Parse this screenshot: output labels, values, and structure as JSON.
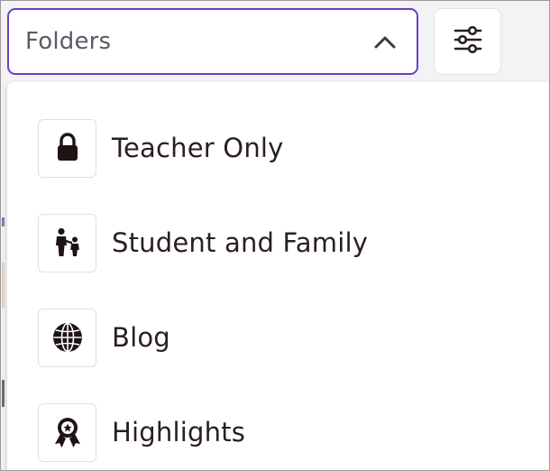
{
  "dropdown": {
    "label": "Folders",
    "chevron_icon": "chevron-up-icon",
    "border_color": "#6b3fbf"
  },
  "filter_button": {
    "icon": "sliders-icon"
  },
  "menu": {
    "items": [
      {
        "label": "Teacher Only",
        "icon": "lock-icon"
      },
      {
        "label": "Student and Family",
        "icon": "parent-child-icon"
      },
      {
        "label": "Blog",
        "icon": "globe-icon"
      },
      {
        "label": "Highlights",
        "icon": "award-ribbon-icon"
      }
    ]
  },
  "colors": {
    "text": "#2a1f1f",
    "placeholder": "#5b5b66",
    "accent": "#6b3fbf"
  }
}
